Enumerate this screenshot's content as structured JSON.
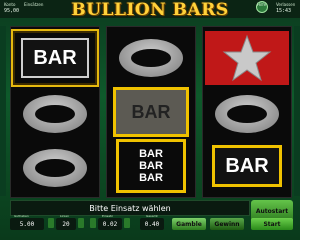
{
  "game": {
    "title": "BULLION BARS"
  },
  "topbar": {
    "left_label1": "Konto",
    "left_label2": "Einsätzen",
    "left_value": "95,00",
    "right_label1": "Hilfe",
    "right_label2": "Verlassen",
    "right_value": "15:43"
  },
  "reels": [
    {
      "symbols": [
        "BAR",
        "ring",
        "ring"
      ]
    },
    {
      "symbols": [
        "ring",
        "BAR",
        "BARBARBAR"
      ]
    },
    {
      "symbols": [
        "star",
        "ring",
        "BAR"
      ]
    }
  ],
  "message": "Bitte Einsatz wählen",
  "autostart": "Autostart",
  "controls": {
    "credits_label": "Guthaben",
    "credits_value": "5.00",
    "lines_label": "Linien",
    "lines_value": "20",
    "bet_label": "Einsatz",
    "bet_value": "0.02",
    "total_label": "Gesamt",
    "total_value": "0.40",
    "gamble": "Gamble",
    "take": "Gewinn",
    "start": "Start"
  },
  "colors": {
    "title": "#ffd23a",
    "accent_gold": "#f0c200",
    "background": "#0e5a2b"
  }
}
